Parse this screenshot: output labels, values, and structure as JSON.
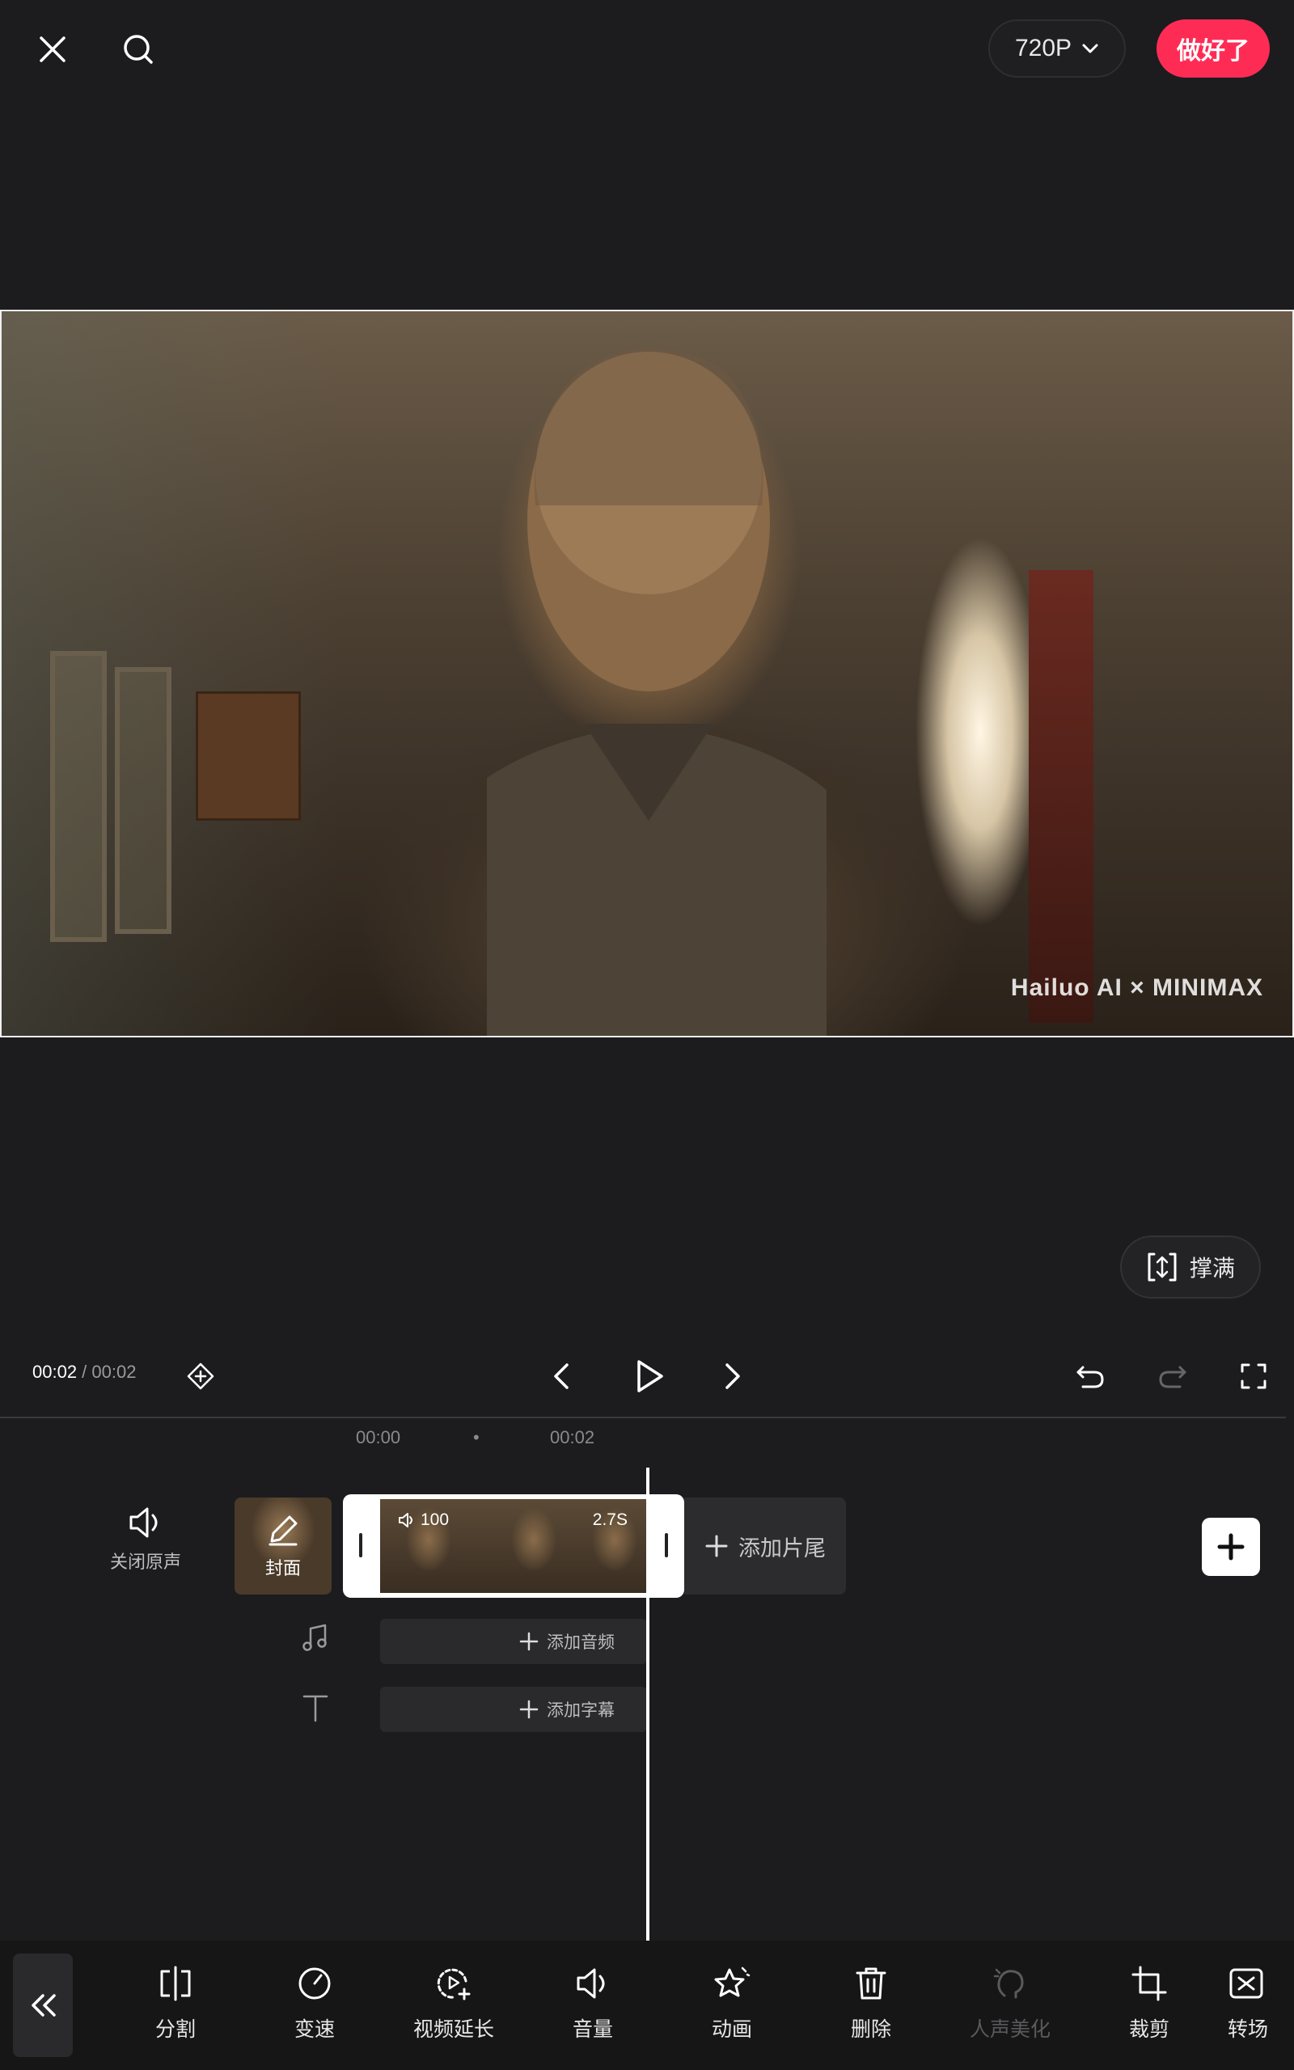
{
  "topbar": {
    "resolution": "720P",
    "done_label": "做好了"
  },
  "preview": {
    "watermark": "Hailuo AI × MINIMAX"
  },
  "fill_label": "撑满",
  "player": {
    "current_time": "00:02",
    "separator": " / ",
    "total_time": "00:02"
  },
  "ruler": {
    "ticks": [
      "00:00",
      "•",
      "00:02"
    ]
  },
  "tracks": {
    "mute_label": "关闭原声",
    "cover_label": "封面",
    "clip_volume": "100",
    "clip_duration": "2.7S",
    "add_tail_label": "添加片尾",
    "add_audio_label": "添加音频",
    "add_subtitle_label": "添加字幕"
  },
  "toolbar": {
    "items": [
      {
        "label": "分割",
        "icon": "split-icon",
        "enabled": true
      },
      {
        "label": "变速",
        "icon": "speed-icon",
        "enabled": true
      },
      {
        "label": "视频延长",
        "icon": "video-extend-icon",
        "enabled": true
      },
      {
        "label": "音量",
        "icon": "volume-icon",
        "enabled": true
      },
      {
        "label": "动画",
        "icon": "animation-icon",
        "enabled": true
      },
      {
        "label": "删除",
        "icon": "delete-icon",
        "enabled": true
      },
      {
        "label": "人声美化",
        "icon": "voice-beautify-icon",
        "enabled": false
      },
      {
        "label": "裁剪",
        "icon": "crop-icon",
        "enabled": true
      },
      {
        "label": "转场",
        "icon": "transition-icon",
        "enabled": true
      }
    ]
  },
  "colors": {
    "accent": "#fe2c55",
    "background": "#1c1c1e"
  }
}
